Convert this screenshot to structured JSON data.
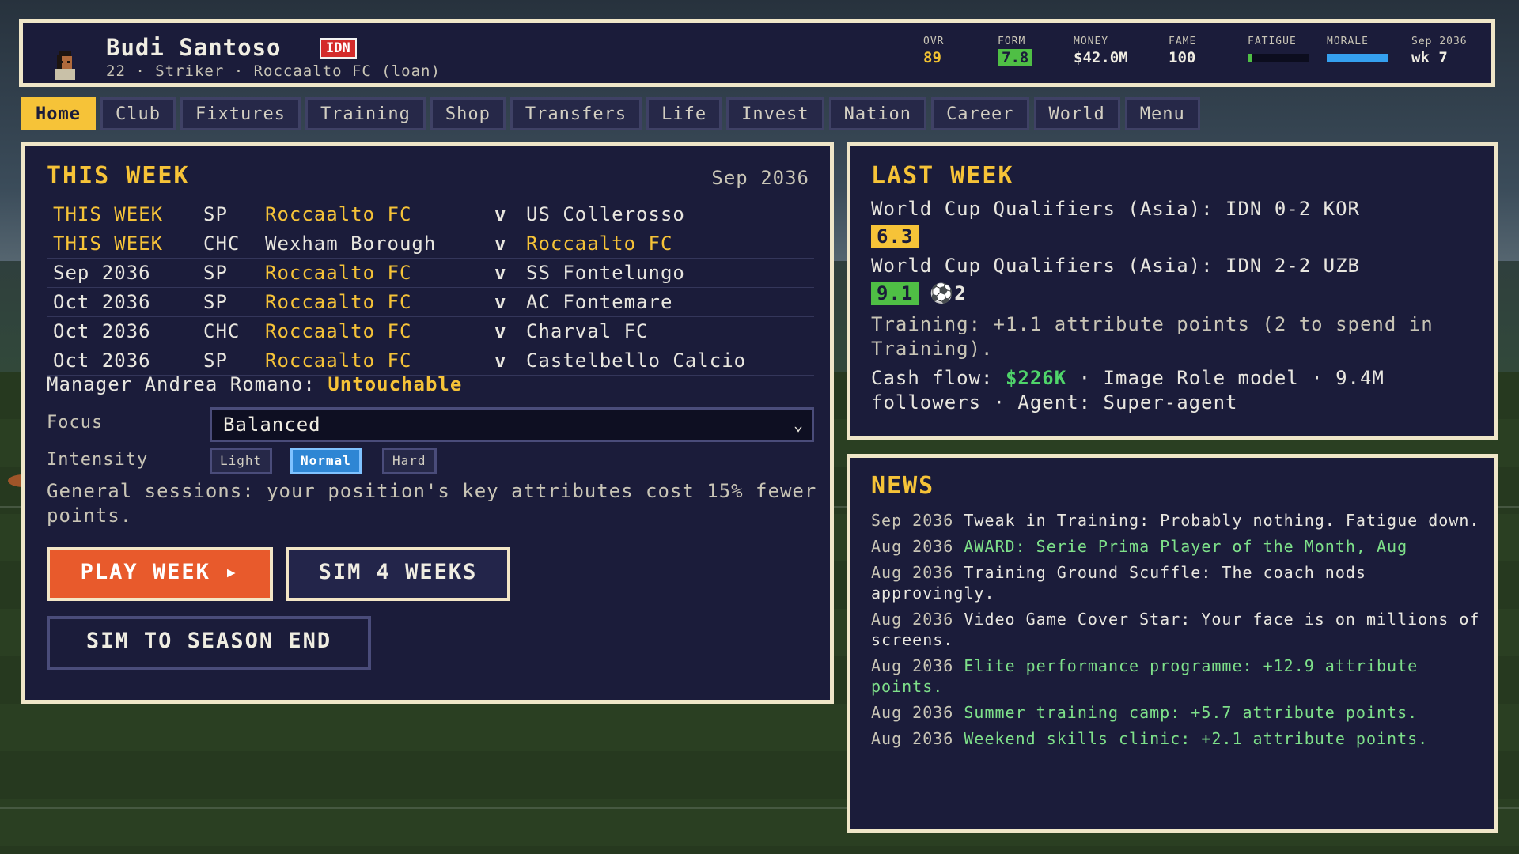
{
  "player": {
    "name": "Budi Santoso",
    "nation": "IDN",
    "subtitle": "22 · Striker · Roccaalto FC (loan)"
  },
  "stats": {
    "ovr_label": "OVR",
    "ovr": "89",
    "form_label": "FORM",
    "form": "7.8",
    "money_label": "MONEY",
    "money": "$42.0M",
    "fame_label": "FAME",
    "fame": "100",
    "fatigue_label": "FATIGUE",
    "fatigue_level": 0.08,
    "morale_label": "MORALE",
    "morale_level": 1.0,
    "date_label": "Sep 2036",
    "week": "wk 7"
  },
  "tabs": [
    "Home",
    "Club",
    "Fixtures",
    "Training",
    "Shop",
    "Transfers",
    "Life",
    "Invest",
    "Nation",
    "Career",
    "World",
    "Menu"
  ],
  "active_tab": "Home",
  "this_week": {
    "title": "THIS WEEK",
    "date": "Sep 2036",
    "fixtures": [
      {
        "date": "THIS WEEK",
        "comp": "SP",
        "home": "Roccaalto FC",
        "v": "v",
        "away": "US Collerosso"
      },
      {
        "date": "THIS WEEK",
        "comp": "CHC",
        "home": "Wexham Borough",
        "v": "v",
        "away": "Roccaalto FC"
      },
      {
        "date": "Sep 2036",
        "comp": "SP",
        "home": "Roccaalto FC",
        "v": "v",
        "away": "SS Fontelungo"
      },
      {
        "date": "Oct 2036",
        "comp": "SP",
        "home": "Roccaalto FC",
        "v": "v",
        "away": "AC Fontemare"
      },
      {
        "date": "Oct 2036",
        "comp": "CHC",
        "home": "Roccaalto FC",
        "v": "v",
        "away": "Charval FC"
      },
      {
        "date": "Oct 2036",
        "comp": "SP",
        "home": "Roccaalto FC",
        "v": "v",
        "away": "Castelbello Calcio"
      }
    ],
    "manager_prefix": "Manager Andrea Romano:",
    "manager_status": "Untouchable",
    "focus_label": "Focus",
    "focus_value": "Balanced",
    "intensity_label": "Intensity",
    "intensity_options": [
      "Light",
      "Normal",
      "Hard"
    ],
    "intensity_selected": "Normal",
    "general_text": "General sessions: your position's key attributes cost 15% fewer points.",
    "play_label": "PLAY WEEK ▸",
    "sim4_label": "SIM 4 WEEKS",
    "simend_label": "SIM TO SEASON END"
  },
  "last_week": {
    "title": "LAST WEEK",
    "match1": "World Cup Qualifiers (Asia): IDN 0-2 KOR",
    "rating1": "6.3",
    "match2": "World Cup Qualifiers (Asia): IDN 2-2 UZB",
    "rating2": "9.1",
    "goals2": "⚽2",
    "training": "Training: +1.1 attribute points (2 to spend in Training).",
    "cash_label": "Cash flow:",
    "cash_value": "$226K",
    "cash_rest": " · Image Role model · 9.4M followers · Agent: Super-agent"
  },
  "news": {
    "title": "NEWS",
    "items": [
      {
        "date": "Sep 2036",
        "text": "Tweak in Training: Probably nothing. Fatigue down.",
        "highlight": false
      },
      {
        "date": "Aug 2036",
        "text": "AWARD: Serie Prima Player of the Month, Aug",
        "highlight": true
      },
      {
        "date": "Aug 2036",
        "text": "Training Ground Scuffle: The coach nods approvingly.",
        "highlight": false
      },
      {
        "date": "Aug 2036",
        "text": "Video Game Cover Star: Your face is on millions of screens.",
        "highlight": false
      },
      {
        "date": "Aug 2036",
        "text": "Elite performance programme: +12.9 attribute points.",
        "highlight": true
      },
      {
        "date": "Aug 2036",
        "text": "Summer training camp: +5.7 attribute points.",
        "highlight": true
      },
      {
        "date": "Aug 2036",
        "text": "Weekend skills clinic: +2.1 attribute points.",
        "highlight": true
      }
    ]
  },
  "colors": {
    "accent": "#f6c338",
    "panel": "#1b1c3a",
    "border": "#efe6c8",
    "play": "#e85a2c",
    "positive": "#4fd46a",
    "flag": "#d42b2b",
    "fatigue_bar": "#4fbf45",
    "morale_bar": "#35a0ef"
  }
}
